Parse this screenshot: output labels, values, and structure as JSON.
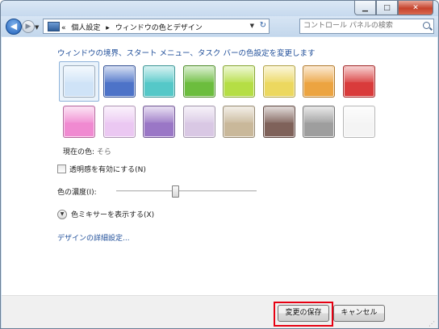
{
  "titlebar": {
    "minimize_icon": "minimize-icon",
    "maximize_icon": "maximize-icon",
    "close_icon": "close-icon"
  },
  "navbar": {
    "breadcrumb": {
      "overflow": "«",
      "items": [
        "個人設定",
        "▸",
        "ウィンドウの色とデザイン"
      ]
    },
    "search": {
      "placeholder": "コントロール パネルの検索"
    }
  },
  "main": {
    "heading": "ウィンドウの境界、スタート メニュー、タスク バーの色設定を変更します",
    "swatches": [
      {
        "color": "#cfe3f7"
      },
      {
        "color": "#4d73c8"
      },
      {
        "color": "#55c8c8"
      },
      {
        "color": "#6cbd3e"
      },
      {
        "color": "#b5de45"
      },
      {
        "color": "#ecd85f"
      },
      {
        "color": "#eca441"
      },
      {
        "color": "#d93b3b"
      },
      {
        "color": "#f08ad1"
      },
      {
        "color": "#ebc8f2"
      },
      {
        "color": "#9a77c6"
      },
      {
        "color": "#d9c8e4"
      },
      {
        "color": "#c9b89a"
      },
      {
        "color": "#7f625a"
      },
      {
        "color": "#9e9e9e"
      },
      {
        "color": "#f4f4f4"
      }
    ],
    "selected_swatch_index": 0,
    "current_color": {
      "label": "現在の色:",
      "value": "そら"
    },
    "transparency": {
      "label": "透明感を有効にする(N)",
      "checked": false
    },
    "intensity": {
      "label": "色の濃度(I):",
      "value_fraction": 0.42
    },
    "mixer": {
      "label": "色ミキサーを表示する(X)"
    },
    "advanced_link": "デザインの詳細設定..."
  },
  "footer": {
    "save_label": "変更の保存",
    "cancel_label": "キャンセル",
    "highlight_color": "#e60012"
  }
}
